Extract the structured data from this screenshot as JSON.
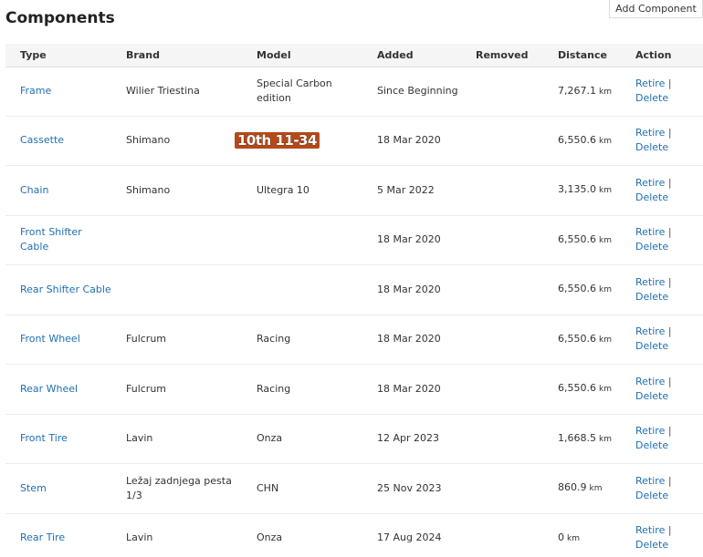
{
  "page": {
    "title": "Components",
    "add_button": "Add Component"
  },
  "table": {
    "headers": [
      "Type",
      "Brand",
      "Model",
      "Added",
      "Removed",
      "Distance",
      "Action"
    ],
    "rows": [
      {
        "type": "Frame",
        "brand": "Wilier Triestina",
        "model": "Special Carbon edition",
        "added": "Since Beginning",
        "removed": "",
        "distance": "7,267.1",
        "unit": "km"
      },
      {
        "type": "Cassette",
        "brand": "Shimano",
        "model": "10th 11-34",
        "added": "18 Mar 2020",
        "removed": "",
        "distance": "6,550.6",
        "unit": "km"
      },
      {
        "type": "Chain",
        "brand": "Shimano",
        "model": "Ultegra 10",
        "added": "5 Mar 2022",
        "removed": "",
        "distance": "3,135.0",
        "unit": "km"
      },
      {
        "type": "Front Shifter Cable",
        "brand": "",
        "model": "",
        "added": "18 Mar 2020",
        "removed": "",
        "distance": "6,550.6",
        "unit": "km"
      },
      {
        "type": "Rear Shifter Cable",
        "brand": "",
        "model": "",
        "added": "18 Mar 2020",
        "removed": "",
        "distance": "6,550.6",
        "unit": "km"
      },
      {
        "type": "Front Wheel",
        "brand": "Fulcrum",
        "model": "Racing",
        "added": "18 Mar 2020",
        "removed": "",
        "distance": "6,550.6",
        "unit": "km"
      },
      {
        "type": "Rear Wheel",
        "brand": "Fulcrum",
        "model": "Racing",
        "added": "18 Mar 2020",
        "removed": "",
        "distance": "6,550.6",
        "unit": "km"
      },
      {
        "type": "Front Tire",
        "brand": "Lavin",
        "model": "Onza",
        "added": "12 Apr 2023",
        "removed": "",
        "distance": "1,668.5",
        "unit": "km"
      },
      {
        "type": "Stem",
        "brand": "Ležaj zadnjega pesta 1/3",
        "model": "CHN",
        "added": "25 Nov 2023",
        "removed": "",
        "distance": "860.9",
        "unit": "km"
      },
      {
        "type": "Rear Tire",
        "brand": "Lavin",
        "model": "Onza",
        "added": "17 Aug 2024",
        "removed": "",
        "distance": "0",
        "unit": "km"
      }
    ],
    "actions": {
      "retire": "Retire",
      "separator": "|",
      "delete": "Delete"
    }
  }
}
